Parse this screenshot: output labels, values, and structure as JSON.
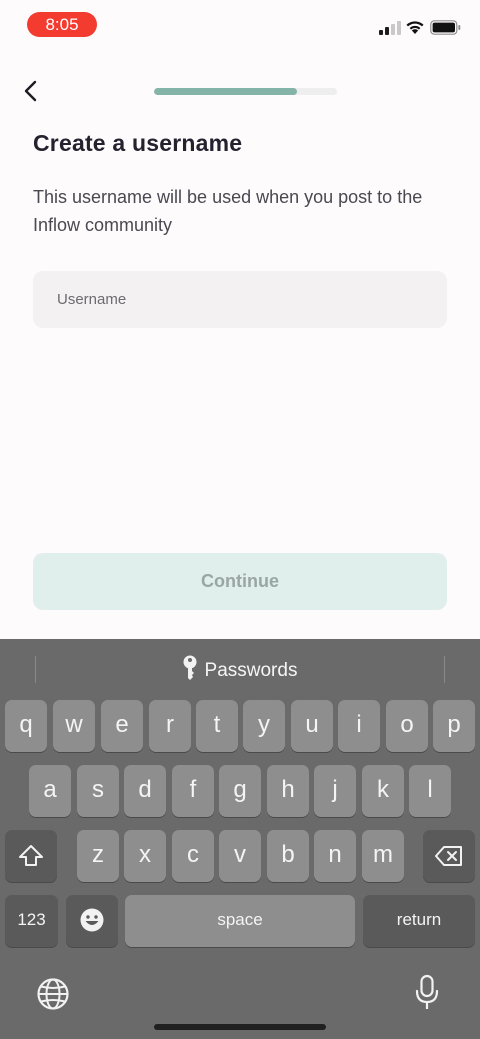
{
  "status_bar": {
    "time": "8:05",
    "signal_icon": "cellular-signal-icon",
    "wifi_icon": "wifi-icon",
    "battery_icon": "battery-icon"
  },
  "header": {
    "back_icon": "chevron-left-icon",
    "progress_fraction": 0.78,
    "progress_color": "#84b3a7"
  },
  "main": {
    "title": "Create a username",
    "subtitle": "This username will be used when you post to the Inflow community",
    "username_input": {
      "value": "",
      "placeholder": "Username"
    },
    "continue_label": "Continue"
  },
  "keyboard": {
    "suggestion_label": "Passwords",
    "suggestion_icon": "key-icon",
    "row1": [
      "q",
      "w",
      "e",
      "r",
      "t",
      "y",
      "u",
      "i",
      "o",
      "p"
    ],
    "row2": [
      "a",
      "s",
      "d",
      "f",
      "g",
      "h",
      "j",
      "k",
      "l"
    ],
    "row3": [
      "z",
      "x",
      "c",
      "v",
      "b",
      "n",
      "m"
    ],
    "shift_icon": "shift-icon",
    "delete_icon": "delete-icon",
    "numbers_label": "123",
    "emoji_icon": "emoji-icon",
    "space_label": "space",
    "return_label": "return",
    "globe_icon": "globe-icon",
    "mic_icon": "microphone-icon"
  }
}
